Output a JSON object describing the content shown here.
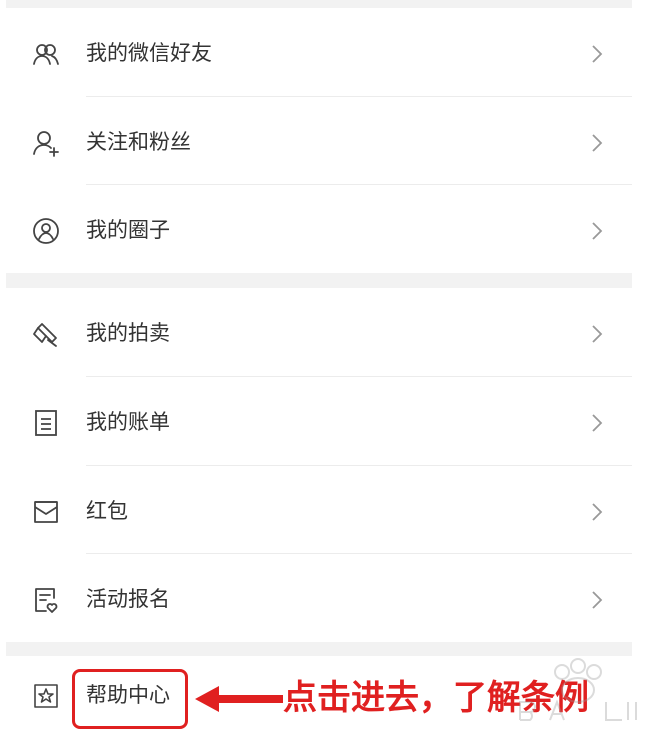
{
  "menu": {
    "group1": [
      {
        "label": "我的微信好友",
        "icon": "friends-icon"
      },
      {
        "label": "关注和粉丝",
        "icon": "follow-icon"
      },
      {
        "label": "我的圈子",
        "icon": "circle-icon"
      }
    ],
    "group2": [
      {
        "label": "我的拍卖",
        "icon": "auction-gavel-icon"
      },
      {
        "label": "我的账单",
        "icon": "bill-icon"
      },
      {
        "label": "红包",
        "icon": "red-packet-icon"
      },
      {
        "label": "活动报名",
        "icon": "event-signup-icon"
      }
    ],
    "group3": [
      {
        "label": "帮助中心",
        "icon": "star-box-icon"
      }
    ]
  },
  "annotation": {
    "text": "点击进去，了解条例",
    "color": "#e02020"
  },
  "colors": {
    "separator": "#f2f2f2",
    "text": "#333333",
    "chevron": "#999999"
  }
}
